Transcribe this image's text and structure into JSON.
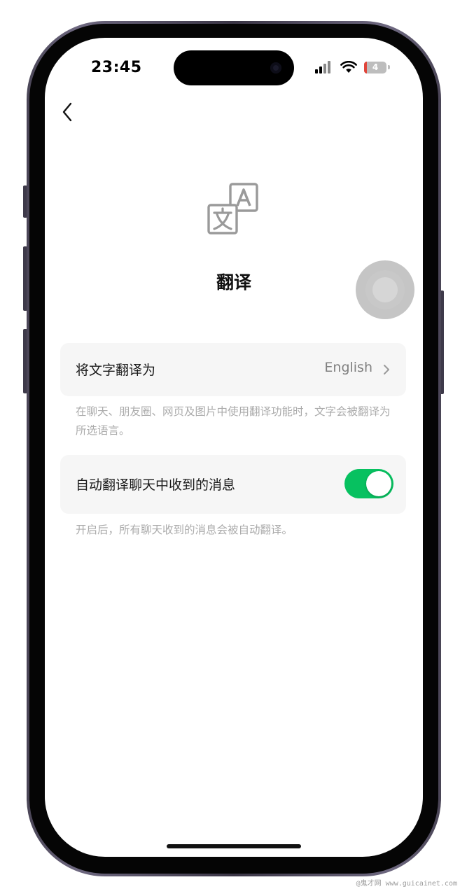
{
  "status_bar": {
    "time": "23:45",
    "battery_level": "4",
    "icons": [
      "signal-icon",
      "wifi-icon",
      "battery-icon"
    ]
  },
  "nav": {
    "back_icon": "chevron-left-icon"
  },
  "header": {
    "icon": "translate-icon",
    "title": "翻译"
  },
  "settings": {
    "translate_to": {
      "label": "将文字翻译为",
      "value": "English",
      "icon": "chevron-right-icon"
    },
    "translate_to_note": "在聊天、朋友圈、网页及图片中使用翻译功能时，文字会被翻译为所选语言。",
    "auto_translate": {
      "label": "自动翻译聊天中收到的消息",
      "enabled": true
    },
    "auto_translate_note": "开启后，所有聊天收到的消息会被自动翻译。"
  },
  "colors": {
    "accent": "#07c160",
    "card_bg": "#f6f6f6",
    "note_text": "#ababab"
  },
  "watermark": "@鬼才网 www.guicainet.com"
}
